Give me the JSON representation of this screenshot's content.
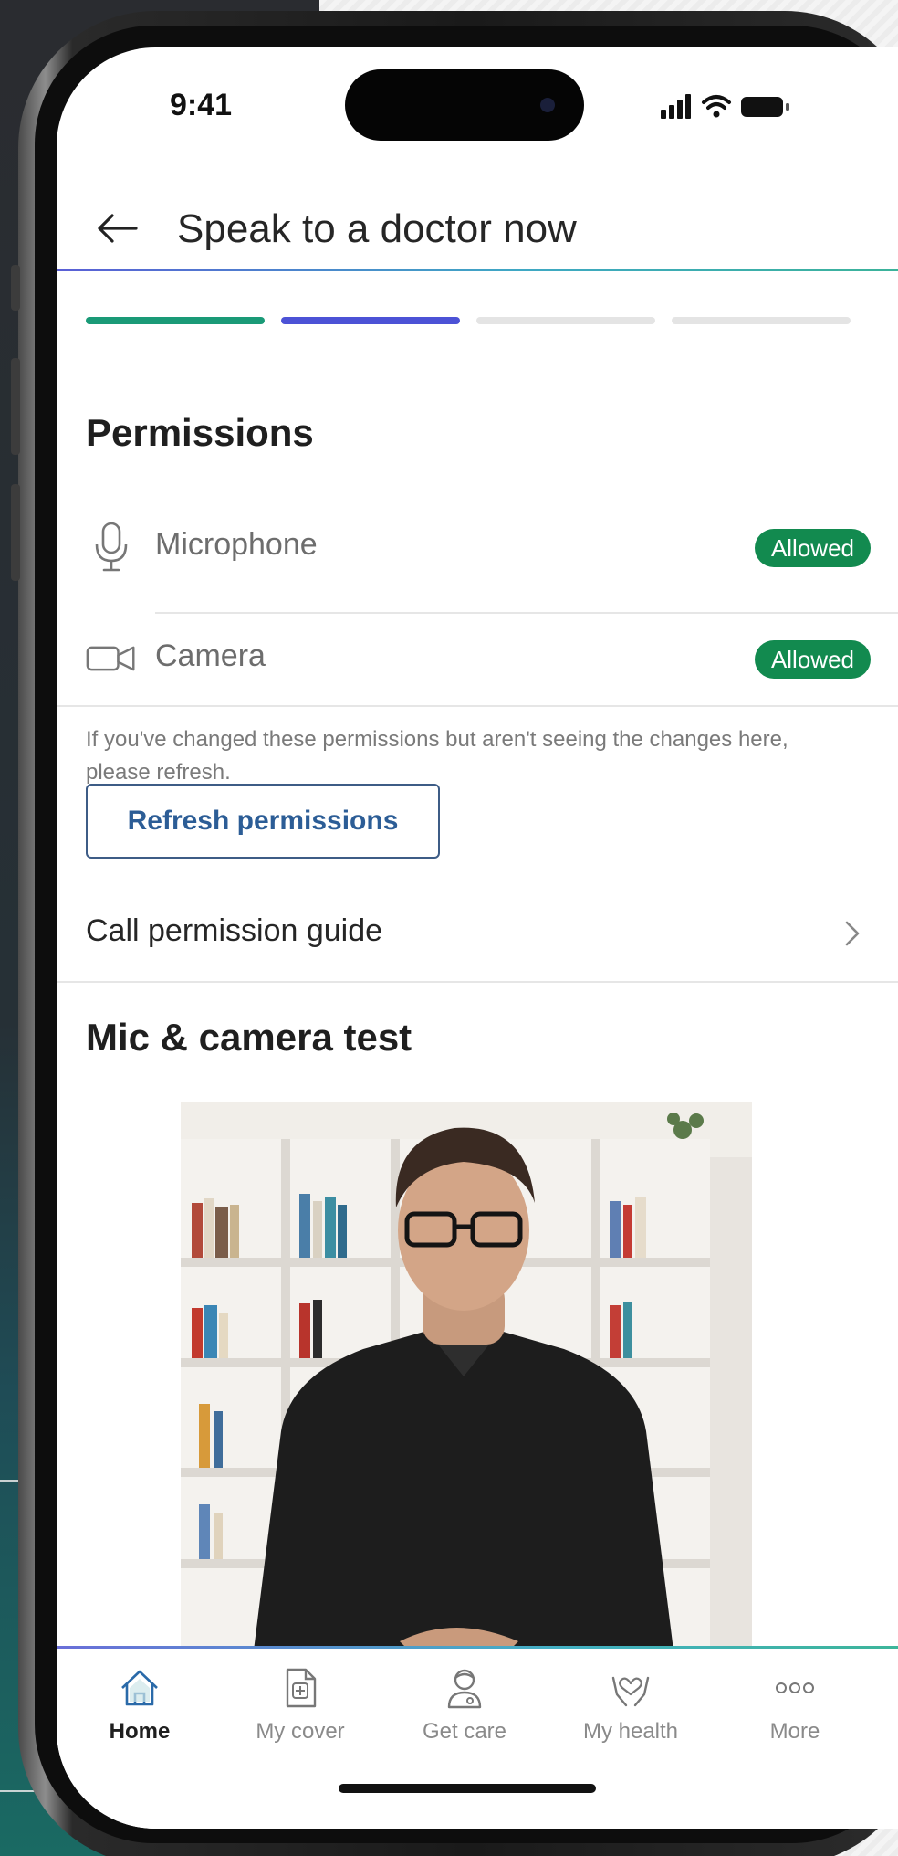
{
  "status_bar": {
    "time": "9:41"
  },
  "header": {
    "title": "Speak to a doctor now"
  },
  "progress": {
    "total_steps": 4,
    "current_step": 2
  },
  "permissions": {
    "heading": "Permissions",
    "items": [
      {
        "label": "Microphone",
        "status": "Allowed",
        "icon": "microphone-icon"
      },
      {
        "label": "Camera",
        "status": "Allowed",
        "icon": "camera-icon"
      }
    ],
    "note": "If you've changed these permissions but aren't seeing the changes here, please refresh.",
    "refresh_button": "Refresh permissions",
    "guide_link": "Call permission guide"
  },
  "test_section": {
    "heading": "Mic & camera test"
  },
  "bottom_nav": {
    "items": [
      {
        "label": "Home",
        "icon": "home-icon",
        "active": true
      },
      {
        "label": "My cover",
        "icon": "document-plus-icon",
        "active": false
      },
      {
        "label": "Get care",
        "icon": "doctor-icon",
        "active": false
      },
      {
        "label": "My health",
        "icon": "heart-hands-icon",
        "active": false
      },
      {
        "label": "More",
        "icon": "more-icon",
        "active": false
      }
    ]
  },
  "colors": {
    "step_done": "#1a9a77",
    "step_current": "#4c52d6",
    "step_pending": "#e4e4e4",
    "badge": "#128a4f",
    "link_blue": "#2c5d96"
  }
}
